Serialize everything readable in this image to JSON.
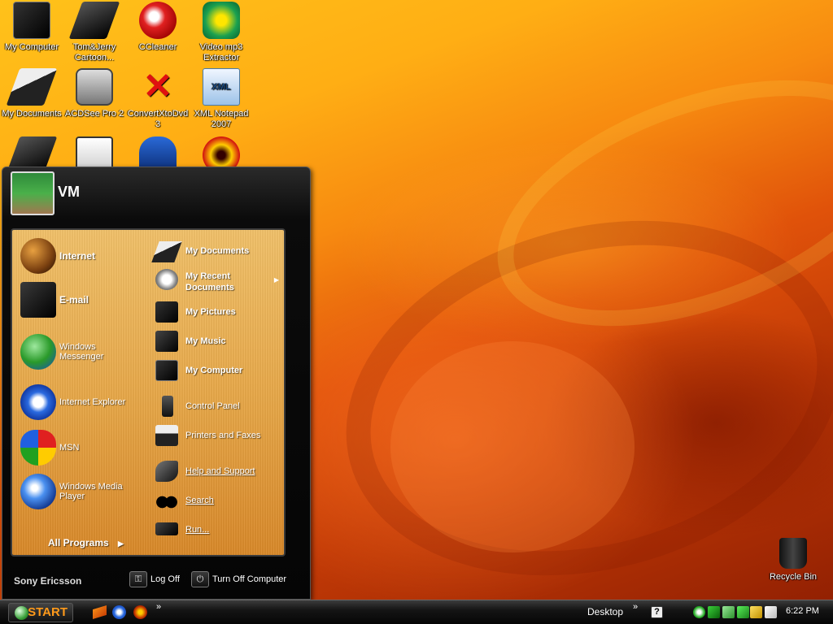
{
  "desktop": {
    "icons": [
      {
        "label": "My Computer",
        "icon": "computer-icon"
      },
      {
        "label": "Tom&Jerry Cartoon...",
        "icon": "folder-icon"
      },
      {
        "label": "CCleaner",
        "icon": "ccleaner-icon"
      },
      {
        "label": "Video mp3 Extractor",
        "icon": "mp3-extractor-icon"
      },
      {
        "label": "My Documents",
        "icon": "documents-icon"
      },
      {
        "label": "ACDSee Pro 2",
        "icon": "camera-icon"
      },
      {
        "label": "ConvertXtoDvd 3",
        "icon": "convertx-icon"
      },
      {
        "label": "XML Notepad 2007",
        "icon": "xml-notepad-icon"
      },
      {
        "label": "Recycle Bin",
        "icon": "recycle-bin-icon"
      }
    ]
  },
  "start_menu": {
    "user_name": "VM",
    "left_items": [
      {
        "label": "Internet",
        "icon": "globe-icon",
        "bold": true
      },
      {
        "label": "E-mail",
        "icon": "mail-icon",
        "bold": true
      },
      {
        "label": "Windows Messenger",
        "icon": "messenger-icon"
      },
      {
        "label": "Internet Explorer",
        "icon": "ie-icon"
      },
      {
        "label": "MSN",
        "icon": "msn-icon"
      },
      {
        "label": "Windows Media Player",
        "icon": "media-player-icon"
      }
    ],
    "all_programs": "All Programs",
    "right_items": [
      {
        "label": "My Documents",
        "icon": "documents-icon",
        "bold": true
      },
      {
        "label": "My Recent Documents",
        "icon": "recent-docs-icon",
        "bold": true
      },
      {
        "label": "My Pictures",
        "icon": "pictures-icon",
        "bold": true
      },
      {
        "label": "My Music",
        "icon": "music-icon",
        "bold": true
      },
      {
        "label": "My Computer",
        "icon": "computer-icon",
        "bold": true
      },
      {
        "label": "Control Panel",
        "icon": "control-panel-icon"
      },
      {
        "label": "Printers and Faxes",
        "icon": "printer-icon"
      },
      {
        "label": "Help and Support",
        "icon": "help-icon"
      },
      {
        "label": "Search",
        "icon": "search-icon"
      },
      {
        "label": "Run...",
        "icon": "run-icon"
      }
    ],
    "brand": "Sony Ericsson",
    "log_off": "Log Off",
    "turn_off": "Turn Off Computer"
  },
  "taskbar": {
    "start_label": "START",
    "toolbar_label": "Desktop",
    "clock": "6:22 PM",
    "chevron": "»"
  },
  "colors": {
    "start_text": "#ff9a1a",
    "menu_panel": "#e8a94a",
    "desktop_accent": "#e0520a"
  }
}
